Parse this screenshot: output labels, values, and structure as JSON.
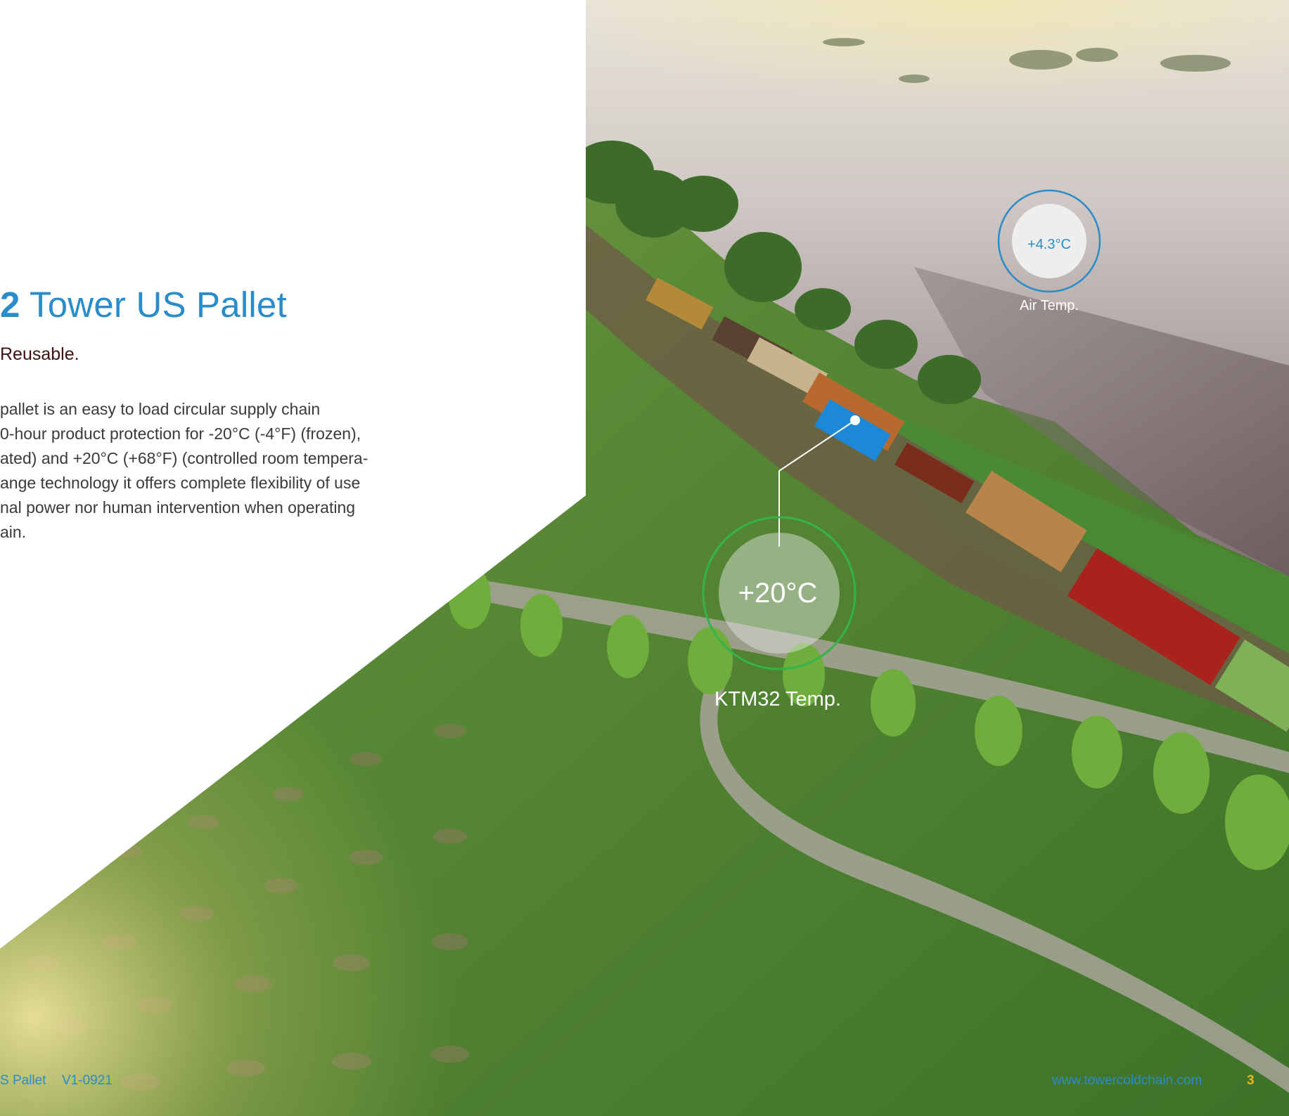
{
  "headline": {
    "number": "2",
    "text": "Tower US Pallet"
  },
  "subhead": "Reusable.",
  "body_lines": [
    "pallet is an easy to load circular supply chain",
    "0-hour product protection for -20°C (-4°F) (frozen),",
    "ated) and +20°C (+68°F) (controlled room tempera-",
    "ange technology it offers complete flexibility of use",
    "nal power nor human intervention when operating",
    "ain."
  ],
  "air_temp": {
    "value": "+4.3°C",
    "caption": "Air Temp."
  },
  "ktm_temp": {
    "value": "+20°C",
    "caption": "KTM32 Temp."
  },
  "footer": {
    "product": "S Pallet",
    "version": "V1-0921",
    "url": "www.towercoldchain.com",
    "page": "3"
  },
  "colors": {
    "brand_blue": "#2a8cc9",
    "accent_green": "#36b24a",
    "page_number": "#e9b51c",
    "pallet_blue": "#1e88d8"
  }
}
